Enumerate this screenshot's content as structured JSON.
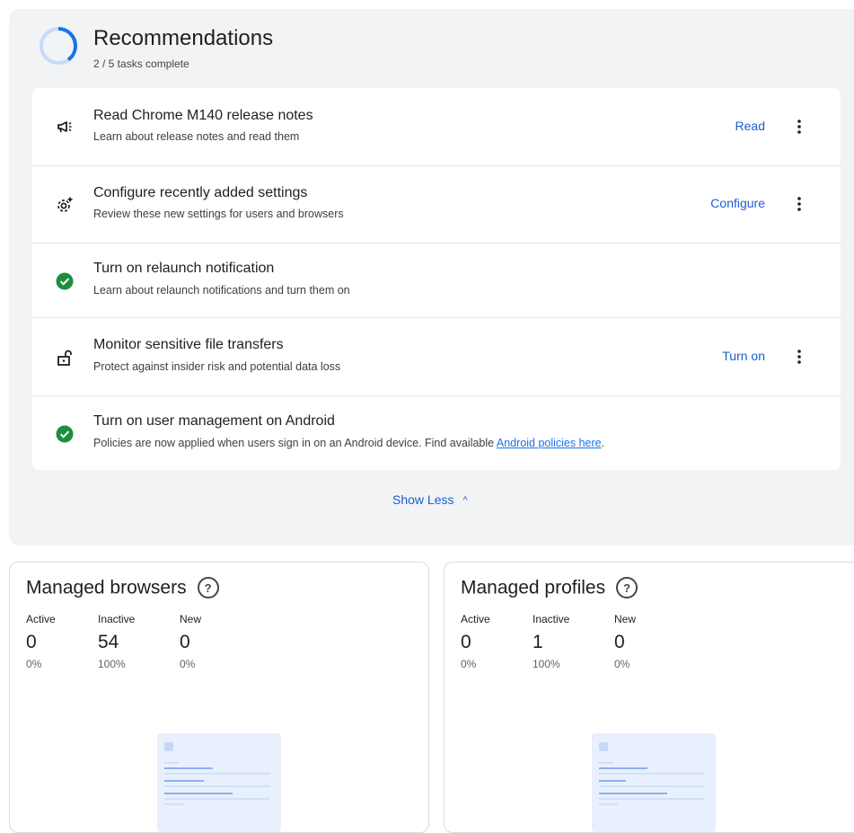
{
  "recommendations": {
    "title": "Recommendations",
    "subtitle": "2 / 5 tasks complete",
    "progress": 0.4,
    "tasks": [
      {
        "icon": "megaphone-icon",
        "title": "Read Chrome M140 release notes",
        "description": "Learn about release notes and read them",
        "action": "Read"
      },
      {
        "icon": "settings-sparkle-icon",
        "title": "Configure recently added settings",
        "description": "Review these new settings for users and browsers",
        "action": "Configure"
      },
      {
        "icon": "check-circle-icon",
        "title": "Turn on relaunch notification",
        "description": "Learn about relaunch notifications and turn them on"
      },
      {
        "icon": "unlock-icon",
        "title": "Monitor sensitive file transfers",
        "description": "Protect against insider risk and potential data loss",
        "action": "Turn on"
      },
      {
        "icon": "check-circle-icon",
        "title": "Turn on user management on Android",
        "description": "Policies are now applied when users sign in on an Android device. Find available ",
        "link": "Android policies here",
        "suffix": "."
      }
    ],
    "show_less": "Show Less"
  },
  "managed_browsers": {
    "title": "Managed browsers",
    "stats": [
      {
        "label": "Active",
        "value": "0",
        "percent": "0%"
      },
      {
        "label": "Inactive",
        "value": "54",
        "percent": "100%"
      },
      {
        "label": "New",
        "value": "0",
        "percent": "0%"
      }
    ]
  },
  "managed_profiles": {
    "title": "Managed profiles",
    "stats": [
      {
        "label": "Active",
        "value": "0",
        "percent": "0%"
      },
      {
        "label": "Inactive",
        "value": "1",
        "percent": "100%"
      },
      {
        "label": "New",
        "value": "0",
        "percent": "0%"
      }
    ]
  },
  "colors": {
    "accent": "#1a73e8",
    "success": "#1e8e3e",
    "card_bg": "#f1f3f4"
  }
}
